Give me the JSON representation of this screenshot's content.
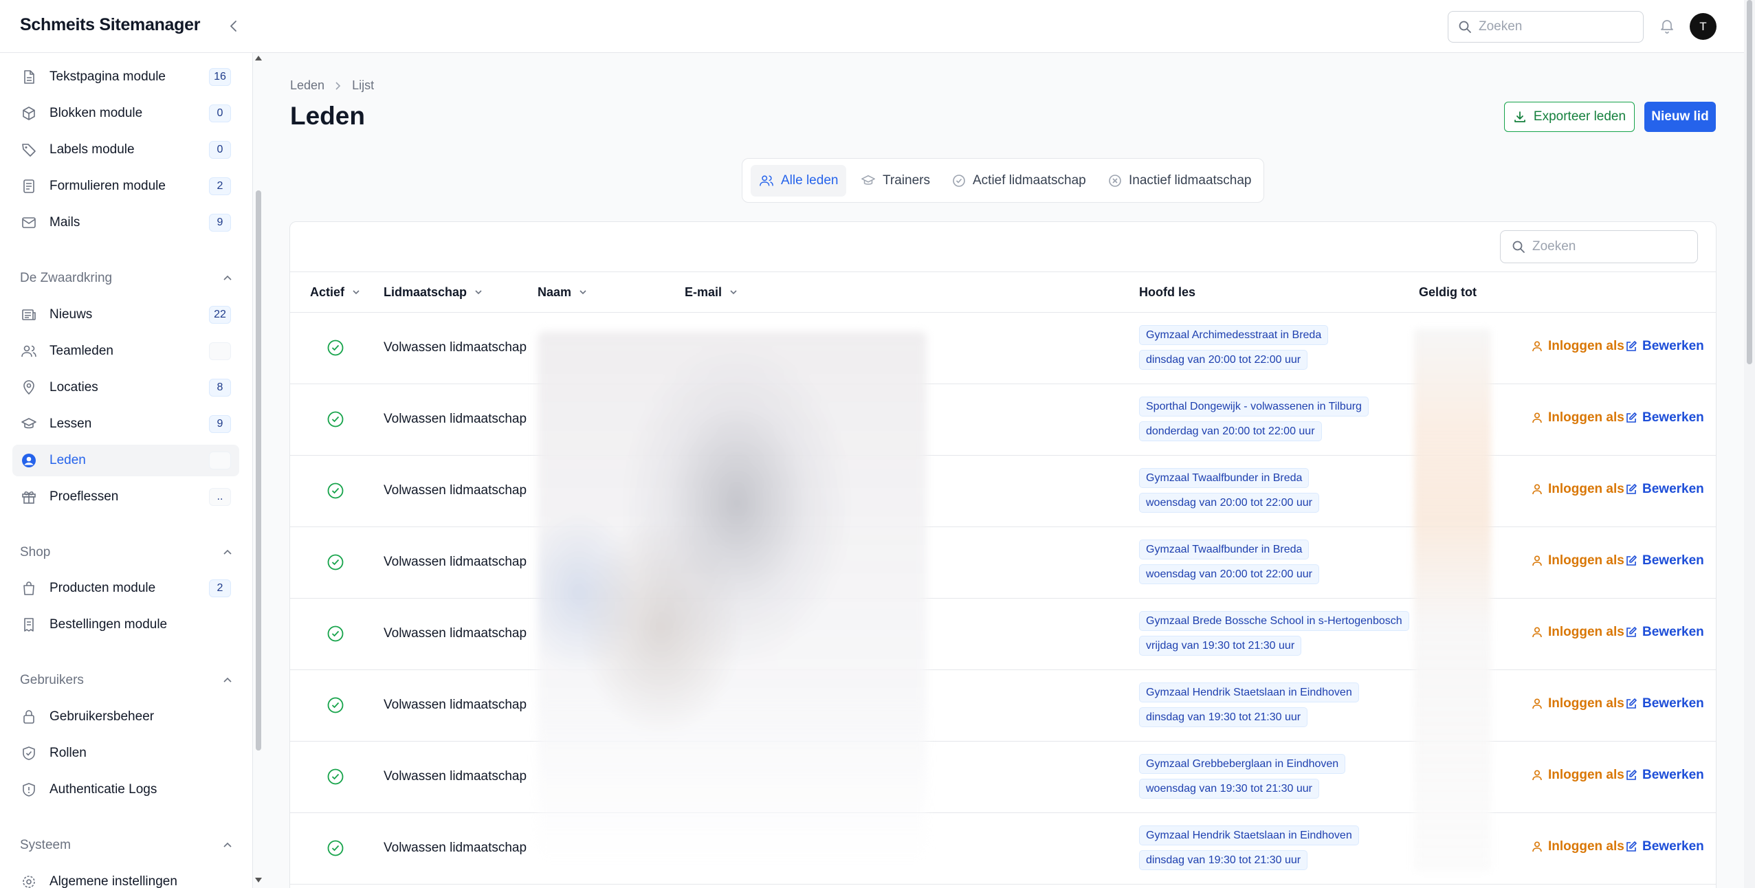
{
  "app": {
    "title": "Schmeits Sitemanager",
    "search_placeholder": "Zoeken",
    "user_initial": "T"
  },
  "sidebar": {
    "top_items": [
      {
        "label": "Tekstpagina module",
        "count": "16",
        "icon": "file-icon"
      },
      {
        "label": "Blokken module",
        "count": "0",
        "icon": "cube-icon"
      },
      {
        "label": "Labels module",
        "count": "0",
        "icon": "tag-icon"
      },
      {
        "label": "Formulieren module",
        "count": "2",
        "icon": "form-icon"
      },
      {
        "label": "Mails",
        "count": "9",
        "icon": "mail-icon"
      }
    ],
    "groups": [
      {
        "title": "De Zwaardkring",
        "items": [
          {
            "label": "Nieuws",
            "count": "22",
            "icon": "newspaper-icon"
          },
          {
            "label": "Teamleden",
            "count": "",
            "icon": "users-icon"
          },
          {
            "label": "Locaties",
            "count": "8",
            "icon": "location-pin-icon"
          },
          {
            "label": "Lessen",
            "count": "9",
            "icon": "graduation-cap-icon"
          },
          {
            "label": "Leden",
            "count": "",
            "icon": "user-circle-icon"
          },
          {
            "label": "Proeflessen",
            "count": "..",
            "icon": "gift-icon"
          }
        ]
      },
      {
        "title": "Shop",
        "items": [
          {
            "label": "Producten module",
            "count": "2",
            "icon": "shopping-bag-icon"
          },
          {
            "label": "Bestellingen module",
            "count": "",
            "icon": "receipt-icon"
          }
        ]
      },
      {
        "title": "Gebruikers",
        "items": [
          {
            "label": "Gebruikersbeheer",
            "count": "",
            "icon": "lock-icon"
          },
          {
            "label": "Rollen",
            "count": "",
            "icon": "shield-check-icon"
          },
          {
            "label": "Authenticatie Logs",
            "count": "",
            "icon": "shield-alert-icon"
          }
        ]
      },
      {
        "title": "Systeem",
        "items": [
          {
            "label": "Algemene instellingen",
            "count": "",
            "icon": "gear-icon"
          }
        ]
      }
    ]
  },
  "main": {
    "breadcrumb": [
      "Leden",
      "Lijst"
    ],
    "title": "Leden",
    "export_label": "Exporteer leden",
    "new_label": "Nieuw lid",
    "tabs": [
      {
        "label": "Alle leden",
        "icon": "users-icon",
        "active": true
      },
      {
        "label": "Trainers",
        "icon": "graduation-cap-icon",
        "active": false
      },
      {
        "label": "Actief lidmaatschap",
        "icon": "check-circle-icon",
        "active": false
      },
      {
        "label": "Inactief lidmaatschap",
        "icon": "x-circle-icon",
        "active": false
      }
    ],
    "table": {
      "search_placeholder": "Zoeken",
      "columns": [
        "Actief",
        "Lidmaatschap",
        "Naam",
        "E-mail",
        "Hoofd les",
        "Geldig tot"
      ],
      "login_label": "Inloggen als",
      "edit_label": "Bewerken",
      "rows": [
        {
          "active": true,
          "membership": "Volwassen lidmaatschap",
          "lesson_location": "Gymzaal Archimedesstraat in Breda",
          "lesson_time": "dinsdag van 20:00 tot 22:00 uur"
        },
        {
          "active": true,
          "membership": "Volwassen lidmaatschap",
          "lesson_location": "Sporthal Dongewijk - volwassenen in Tilburg",
          "lesson_time": "donderdag van 20:00 tot 22:00 uur"
        },
        {
          "active": true,
          "membership": "Volwassen lidmaatschap",
          "lesson_location": "Gymzaal Twaalfbunder in Breda",
          "lesson_time": "woensdag van 20:00 tot 22:00 uur"
        },
        {
          "active": true,
          "membership": "Volwassen lidmaatschap",
          "lesson_location": "Gymzaal Twaalfbunder in Breda",
          "lesson_time": "woensdag van 20:00 tot 22:00 uur"
        },
        {
          "active": true,
          "membership": "Volwassen lidmaatschap",
          "lesson_location": "Gymzaal Brede Bossche School in s-Hertogenbosch",
          "lesson_time": "vrijdag van 19:30 tot 21:30 uur"
        },
        {
          "active": true,
          "membership": "Volwassen lidmaatschap",
          "lesson_location": "Gymzaal Hendrik Staetslaan in Eindhoven",
          "lesson_time": "dinsdag van 19:30 tot 21:30 uur"
        },
        {
          "active": true,
          "membership": "Volwassen lidmaatschap",
          "lesson_location": "Gymzaal Grebbeberglaan in Eindhoven",
          "lesson_time": "woensdag van 19:30 tot 21:30 uur"
        },
        {
          "active": true,
          "membership": "Volwassen lidmaatschap",
          "lesson_location": "Gymzaal Hendrik Staetslaan in Eindhoven",
          "lesson_time": "dinsdag van 19:30 tot 21:30 uur"
        }
      ]
    }
  },
  "colors": {
    "primary": "#2563eb",
    "success": "#16a34a",
    "warning": "#d97706"
  }
}
